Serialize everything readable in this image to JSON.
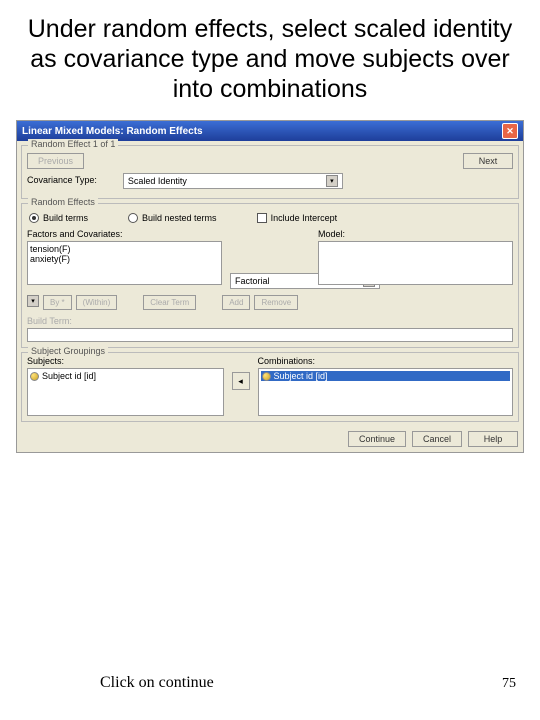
{
  "instruction": "Under random effects, select scaled identity as covariance type and move subjects over into combinations",
  "dialog": {
    "title": "Linear Mixed Models: Random Effects"
  },
  "section1": {
    "title": "Random Effect 1 of 1",
    "prev": "Previous",
    "next": "Next",
    "cov_label": "Covariance Type:",
    "cov_value": "Scaled Identity"
  },
  "section2": {
    "title": "Random Effects",
    "radio_build": "Build terms",
    "radio_nested": "Build nested terms",
    "check_intercept": "Include Intercept",
    "factors_label": "Factors and Covariates:",
    "model_label": "Model:",
    "factors": [
      "tension(F)",
      "anxiety(F)"
    ],
    "interaction": "Factorial",
    "by": "By *",
    "within": "(Within)",
    "clear": "Clear Term",
    "add": "Add",
    "remove": "Remove",
    "build_term_label": "Build Term:"
  },
  "section3": {
    "title": "Subject Groupings",
    "subjects_label": "Subjects:",
    "combinations_label": "Combinations:",
    "subj_item": "Subject id [id]",
    "comb_item": "Subject id [id]"
  },
  "buttons": {
    "continue": "Continue",
    "cancel": "Cancel",
    "help": "Help"
  },
  "footer": "Click on continue",
  "page": "75"
}
